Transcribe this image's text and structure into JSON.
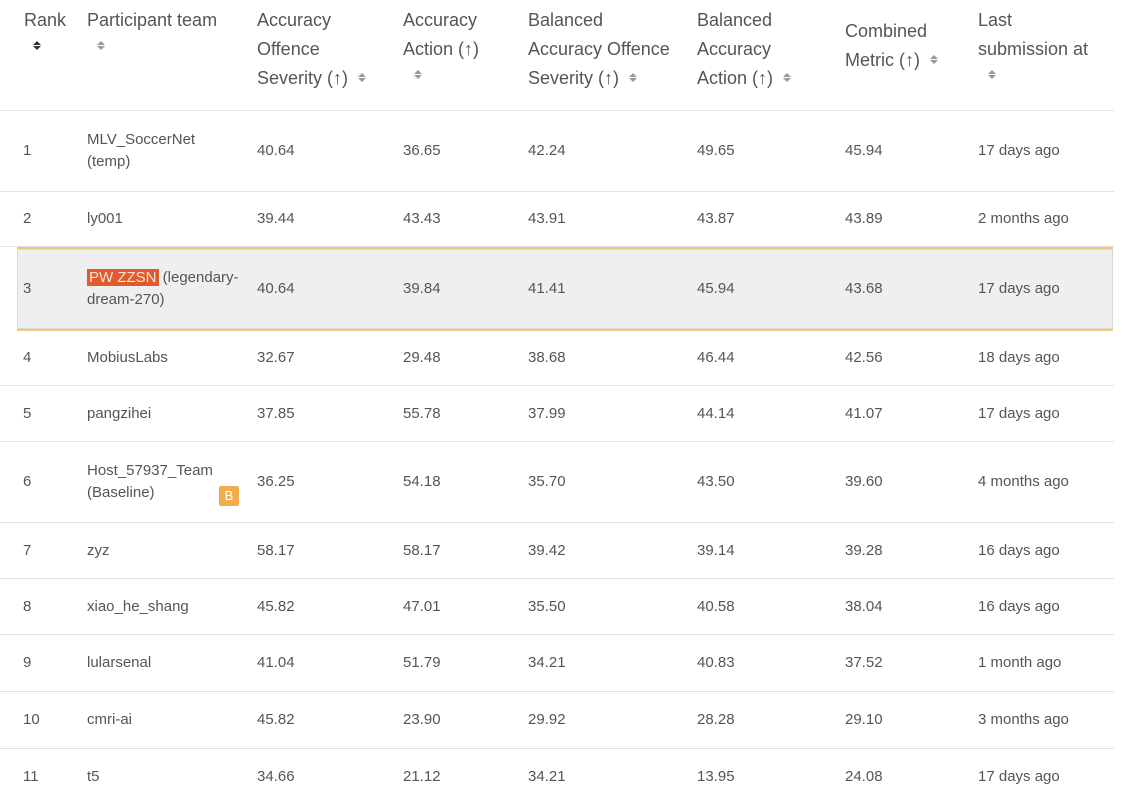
{
  "headers": {
    "rank": "Rank",
    "team": "Participant team",
    "acc_offence": [
      "Accuracy",
      "Offence",
      "Severity (↑)"
    ],
    "acc_action": [
      "Accuracy",
      "Action (↑)"
    ],
    "bal_offence": [
      "Balanced",
      "Accuracy Offence",
      "Severity (↑)"
    ],
    "bal_action": [
      "Balanced",
      "Accuracy",
      "Action (↑)"
    ],
    "combined": [
      "Combined",
      "Metric (↑)"
    ],
    "last": [
      "Last",
      "submission at"
    ]
  },
  "rows": [
    {
      "rank": "1",
      "team": [
        "MLV_SoccerNet",
        "(temp)"
      ],
      "acc_off": "40.64",
      "acc_act": "36.65",
      "bal_off": "42.24",
      "bal_act": "49.65",
      "combined": "45.94",
      "last": "17 days ago"
    },
    {
      "rank": "2",
      "team": [
        "ly001"
      ],
      "acc_off": "39.44",
      "acc_act": "43.43",
      "bal_off": "43.91",
      "bal_act": "43.87",
      "combined": "43.89",
      "last": "2 months ago"
    },
    {
      "rank": "3",
      "team_tag": "PW ZZSN",
      "team": [
        "(legendary-",
        "dream-270)"
      ],
      "acc_off": "40.64",
      "acc_act": "39.84",
      "bal_off": "41.41",
      "bal_act": "45.94",
      "combined": "43.68",
      "last": "17 days ago"
    },
    {
      "rank": "4",
      "team": [
        "MobiusLabs"
      ],
      "acc_off": "32.67",
      "acc_act": "29.48",
      "bal_off": "38.68",
      "bal_act": "46.44",
      "combined": "42.56",
      "last": "18 days ago"
    },
    {
      "rank": "5",
      "team": [
        "pangzihei"
      ],
      "acc_off": "37.85",
      "acc_act": "55.78",
      "bal_off": "37.99",
      "bal_act": "44.14",
      "combined": "41.07",
      "last": "17 days ago"
    },
    {
      "rank": "6",
      "team": [
        "Host_57937_Team",
        "(Baseline)"
      ],
      "badge": "B",
      "acc_off": "36.25",
      "acc_act": "54.18",
      "bal_off": "35.70",
      "bal_act": "43.50",
      "combined": "39.60",
      "last": "4 months ago"
    },
    {
      "rank": "7",
      "team": [
        "zyz"
      ],
      "acc_off": "58.17",
      "acc_act": "58.17",
      "bal_off": "39.42",
      "bal_act": "39.14",
      "combined": "39.28",
      "last": "16 days ago"
    },
    {
      "rank": "8",
      "team": [
        "xiao_he_shang"
      ],
      "acc_off": "45.82",
      "acc_act": "47.01",
      "bal_off": "35.50",
      "bal_act": "40.58",
      "combined": "38.04",
      "last": "16 days ago"
    },
    {
      "rank": "9",
      "team": [
        "lularsenal"
      ],
      "acc_off": "41.04",
      "acc_act": "51.79",
      "bal_off": "34.21",
      "bal_act": "40.83",
      "combined": "37.52",
      "last": "1 month ago"
    },
    {
      "rank": "10",
      "team": [
        "cmri-ai"
      ],
      "acc_off": "45.82",
      "acc_act": "23.90",
      "bal_off": "29.92",
      "bal_act": "28.28",
      "combined": "29.10",
      "last": "3 months ago"
    },
    {
      "rank": "11",
      "team": [
        "t5"
      ],
      "acc_off": "34.66",
      "acc_act": "21.12",
      "bal_off": "34.21",
      "bal_act": "13.95",
      "combined": "24.08",
      "last": "17 days ago"
    }
  ],
  "colors": {
    "highlight_border": "#f3c77a",
    "highlight_bg": "#efefef",
    "tag_bg": "#e05a2b",
    "badge_bg": "#f0ad4e",
    "text": "#555555"
  }
}
